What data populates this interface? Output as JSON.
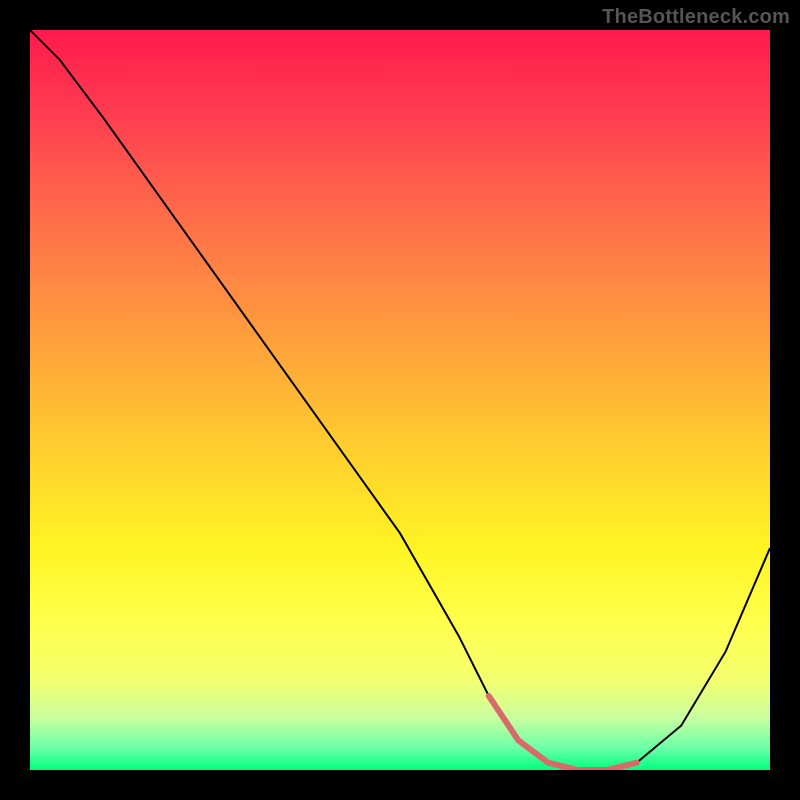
{
  "watermark": "TheBottleneck.com",
  "chart_data": {
    "type": "line",
    "title": "",
    "xlabel": "",
    "ylabel": "",
    "xlim": [
      0,
      100
    ],
    "ylim": [
      0,
      100
    ],
    "grid": false,
    "legend": null,
    "annotations": [],
    "background_gradient": {
      "type": "linear-vertical",
      "stops": [
        {
          "pos": 0,
          "color": "#ff1a4d"
        },
        {
          "pos": 12,
          "color": "#ff3f50"
        },
        {
          "pos": 25,
          "color": "#ff6c4a"
        },
        {
          "pos": 40,
          "color": "#ff9a3e"
        },
        {
          "pos": 55,
          "color": "#ffc92f"
        },
        {
          "pos": 70,
          "color": "#fff423"
        },
        {
          "pos": 80,
          "color": "#ffff4c"
        },
        {
          "pos": 88,
          "color": "#f3ff70"
        },
        {
          "pos": 93,
          "color": "#c8ffa0"
        },
        {
          "pos": 97,
          "color": "#6cffa8"
        },
        {
          "pos": 100,
          "color": "#00ff7f"
        }
      ]
    },
    "series": [
      {
        "name": "bottleneck-curve",
        "color": "#000000",
        "stroke_width": 2,
        "x": [
          0,
          4,
          10,
          20,
          30,
          40,
          50,
          58,
          62,
          66,
          70,
          74,
          78,
          82,
          88,
          94,
          100
        ],
        "values": [
          100,
          96,
          88,
          74,
          60,
          46,
          32,
          18,
          10,
          4,
          1,
          0,
          0,
          1,
          6,
          16,
          30
        ]
      },
      {
        "name": "highlight-trough",
        "color": "#d96a6a",
        "stroke_width": 6,
        "x": [
          62,
          66,
          70,
          74,
          78,
          82
        ],
        "values": [
          10,
          4,
          1,
          0,
          0,
          1
        ]
      }
    ]
  }
}
